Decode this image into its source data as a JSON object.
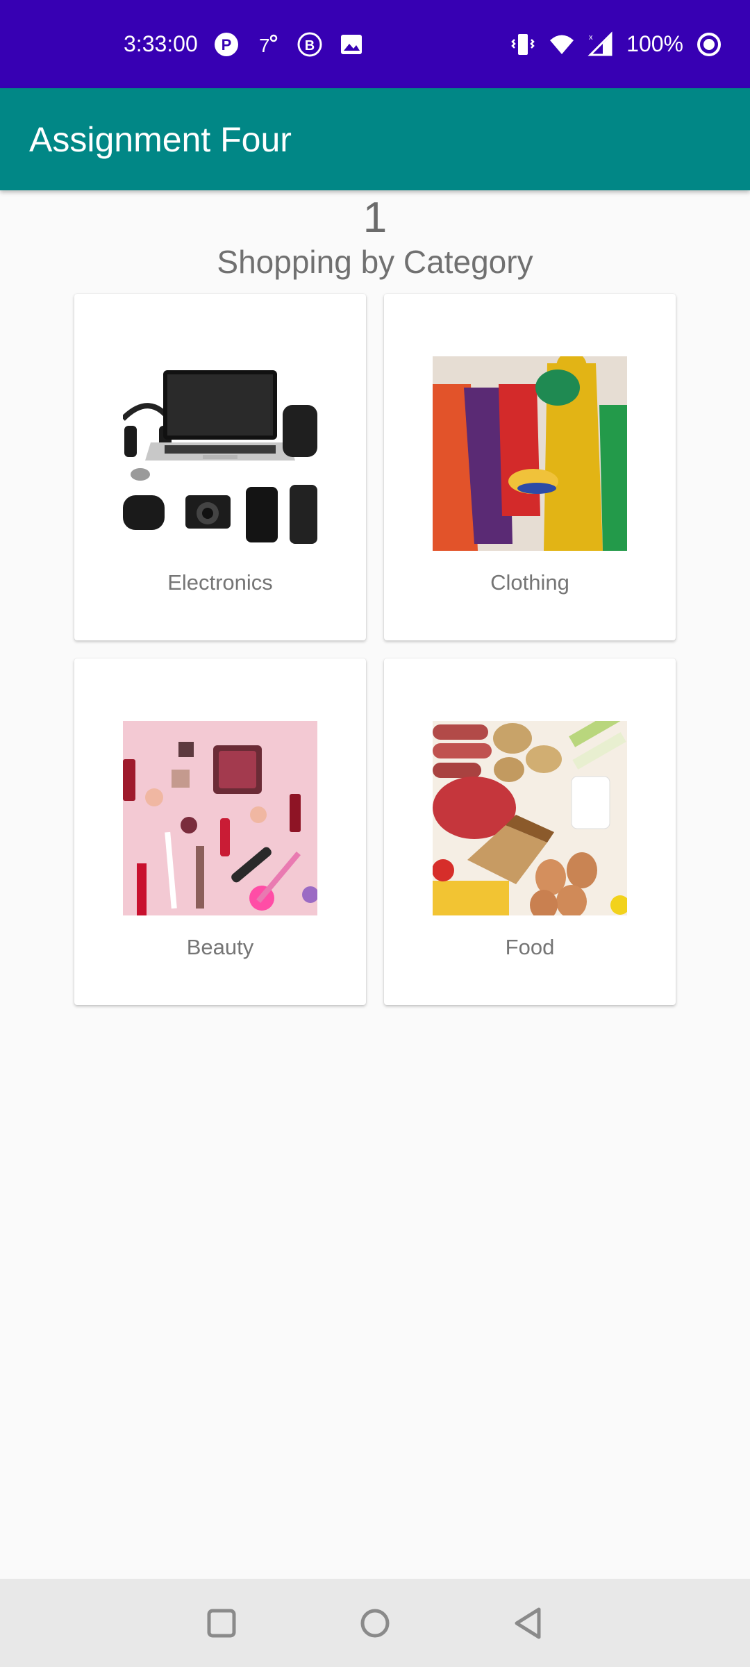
{
  "status_bar": {
    "time": "3:33:00",
    "battery": "100%",
    "left_icons": [
      "p-badge-icon",
      "temperature-icon",
      "b-badge-icon",
      "image-icon"
    ],
    "right_icons": [
      "vibrate-icon",
      "wifi-icon",
      "signal-icon",
      "battery-ring-icon"
    ]
  },
  "app_bar": {
    "title": "Assignment Four"
  },
  "main": {
    "counter": "1",
    "heading": "Shopping by Category",
    "categories": [
      {
        "label": "Electronics",
        "image": "electronics-image"
      },
      {
        "label": "Clothing",
        "image": "clothing-image"
      },
      {
        "label": "Beauty",
        "image": "beauty-image"
      },
      {
        "label": "Food",
        "image": "food-image"
      }
    ]
  },
  "nav_bar": {
    "buttons": [
      "recents-button",
      "home-button",
      "back-button"
    ]
  },
  "colors": {
    "status_bar": "#3700b3",
    "app_bar": "#018786",
    "background": "#fafafa",
    "text_gray": "#757575"
  }
}
